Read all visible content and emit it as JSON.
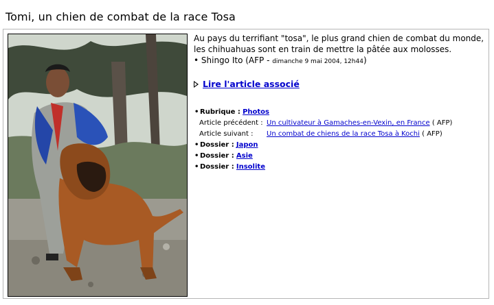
{
  "page": {
    "title": "Tomi, un chien de combat de la race Tosa"
  },
  "caption": {
    "text": "Au pays du terrifiant \"tosa\", le plus grand chien de combat du monde, les chihuahuas sont en train de mettre la pâtée aux molosses.",
    "credit_prefix": "• Shingo Ito (AFP - ",
    "credit_date": "dimanche 9 mai 2004, 12h44",
    "credit_suffix": ")"
  },
  "read_link": {
    "label": "Lire l'article associé"
  },
  "meta": {
    "rubrique": {
      "label": "Rubrique :",
      "value": "Photos"
    },
    "previous": {
      "label": "Article précédent :",
      "value": "Un cultivateur à Gamaches-en-Vexin, en France",
      "source": "( AFP)"
    },
    "next": {
      "label": "Article suivant :",
      "value": "Un combat de chiens de la race Tosa à Kochi",
      "source": "( AFP)"
    },
    "dossiers": [
      {
        "label": "Dossier :",
        "value": "Japon"
      },
      {
        "label": "Dossier :",
        "value": "Asie"
      },
      {
        "label": "Dossier :",
        "value": "Insolite"
      }
    ]
  },
  "colors": {
    "link": "#0000cc",
    "frame": "#b5b5b5"
  },
  "icons": {
    "bullet": "•",
    "arrow": "triangle-right-icon"
  }
}
